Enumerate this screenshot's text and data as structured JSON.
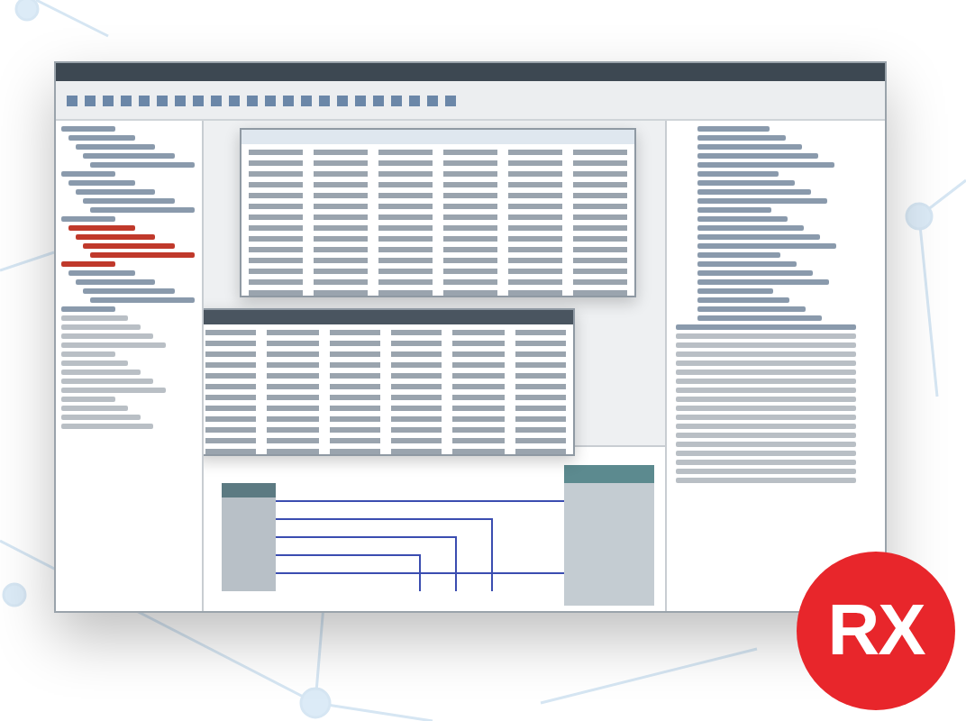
{
  "logo": {
    "text": "RX"
  }
}
